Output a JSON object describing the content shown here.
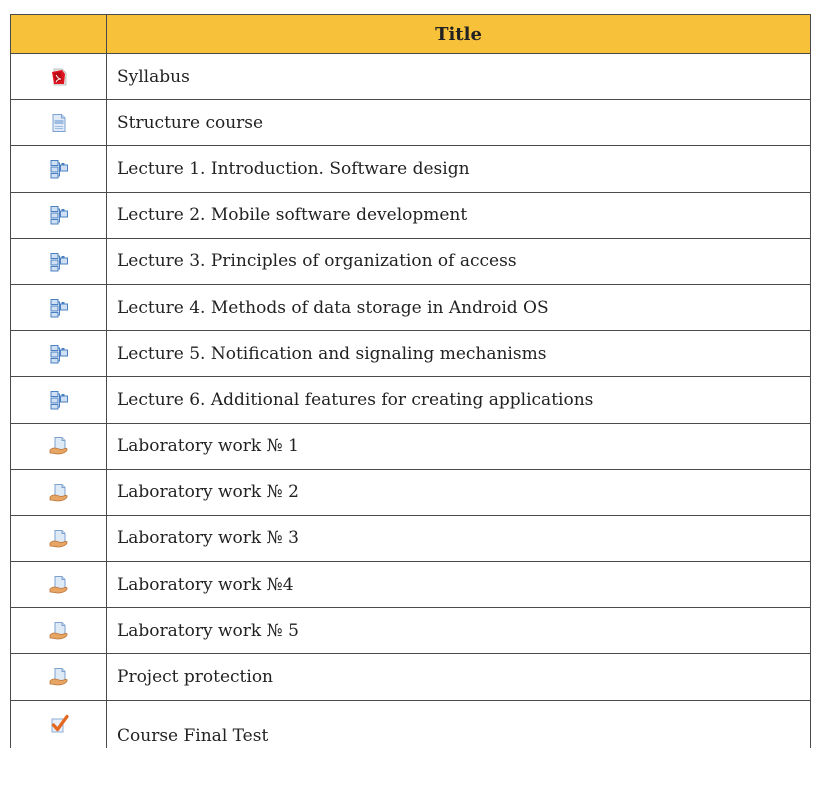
{
  "table": {
    "header": {
      "icon_col": "",
      "title_col": "Title"
    },
    "header_color": "#f7c23a",
    "rows": [
      {
        "icon": "pdf-icon",
        "title": "Syllabus"
      },
      {
        "icon": "page-icon",
        "title": "Structure course"
      },
      {
        "icon": "book-icon",
        "title": "Lecture 1. Introduction. Software design"
      },
      {
        "icon": "book-icon",
        "title": "Lecture 2. Mobile software development"
      },
      {
        "icon": "book-icon",
        "title": "Lecture 3. Principles of organization of access"
      },
      {
        "icon": "book-icon",
        "title": "Lecture 4. Methods of data storage in Android OS"
      },
      {
        "icon": "book-icon",
        "title": "Lecture 5. Notification and signaling mechanisms"
      },
      {
        "icon": "book-icon",
        "title": "Lecture 6. Additional features for creating applications"
      },
      {
        "icon": "assignment-icon",
        "title": "Laboratory work № 1"
      },
      {
        "icon": "assignment-icon",
        "title": "Laboratory work № 2"
      },
      {
        "icon": "assignment-icon",
        "title": "Laboratory work № 3"
      },
      {
        "icon": "assignment-icon",
        "title": "Laboratory work №4"
      },
      {
        "icon": "assignment-icon",
        "title": "Laboratory work № 5"
      },
      {
        "icon": "assignment-icon",
        "title": "Project protection"
      },
      {
        "icon": "quiz-icon",
        "title": "Course Final Test"
      }
    ]
  }
}
